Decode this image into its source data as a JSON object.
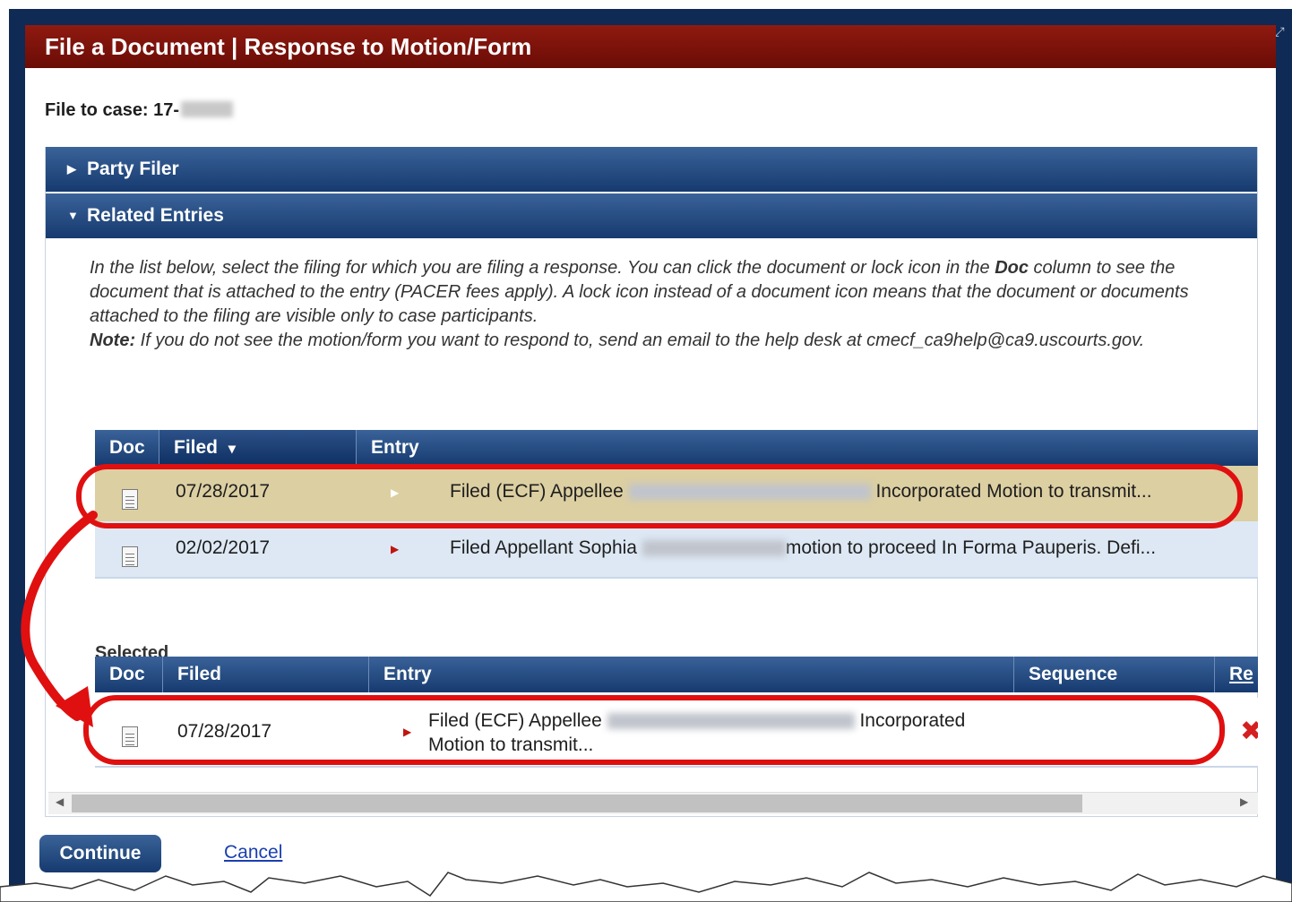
{
  "dialog": {
    "title": "File a Document | Response to Motion/Form",
    "expand_icon": "expand-icon"
  },
  "case": {
    "label": "File to case: 17-"
  },
  "sections": {
    "party_filer": "Party Filer",
    "related_entries": "Related Entries"
  },
  "instructions": {
    "part1": "In the list below, select the filing for which you are filing a response. You can click the document or lock icon in the ",
    "doc_word": "Doc",
    "part2": " column to see the document that is attached to the entry (PACER fees apply). A lock icon instead of a document icon means that the document or documents attached to the filing are visible only to case participants.",
    "note_label": "Note:",
    "note_text": " If you do not see the motion/form you want to respond to, send an email to the help desk at cmecf_ca9help@ca9.uscourts.gov."
  },
  "related_table": {
    "columns": [
      "Doc",
      "Filed",
      "Entry"
    ],
    "sort_indicator": "▾",
    "rows": [
      {
        "filed": "07/28/2017",
        "entry_prefix": "Filed (ECF) Appellee",
        "entry_suffix": "Incorporated Motion to transmit...",
        "selected": true
      },
      {
        "filed": "02/02/2017",
        "entry_prefix": "Filed Appellant Sophia",
        "entry_suffix": "motion to proceed In Forma Pauperis. Defi...",
        "selected": false
      }
    ]
  },
  "selected_table": {
    "label": "Selected",
    "columns": [
      "Doc",
      "Filed",
      "Entry",
      "Sequence",
      "Re"
    ],
    "rows": [
      {
        "filed": "07/28/2017",
        "entry_line1_prefix": "Filed (ECF) Appellee",
        "entry_line1_suffix": "Incorporated",
        "entry_line2": "Motion to transmit...",
        "sequence": ""
      }
    ]
  },
  "actions": {
    "continue": "Continue",
    "cancel": "Cancel"
  },
  "icons": {
    "document": "document-icon",
    "remove": "remove-x-icon",
    "expand_row": "caret-right-icon"
  },
  "colors": {
    "title_bar": "#7a1209",
    "header_blue": "#1f467e",
    "selected_row": "#dccfa2",
    "alt_row": "#dde8f4",
    "callout_red": "#e01010"
  }
}
